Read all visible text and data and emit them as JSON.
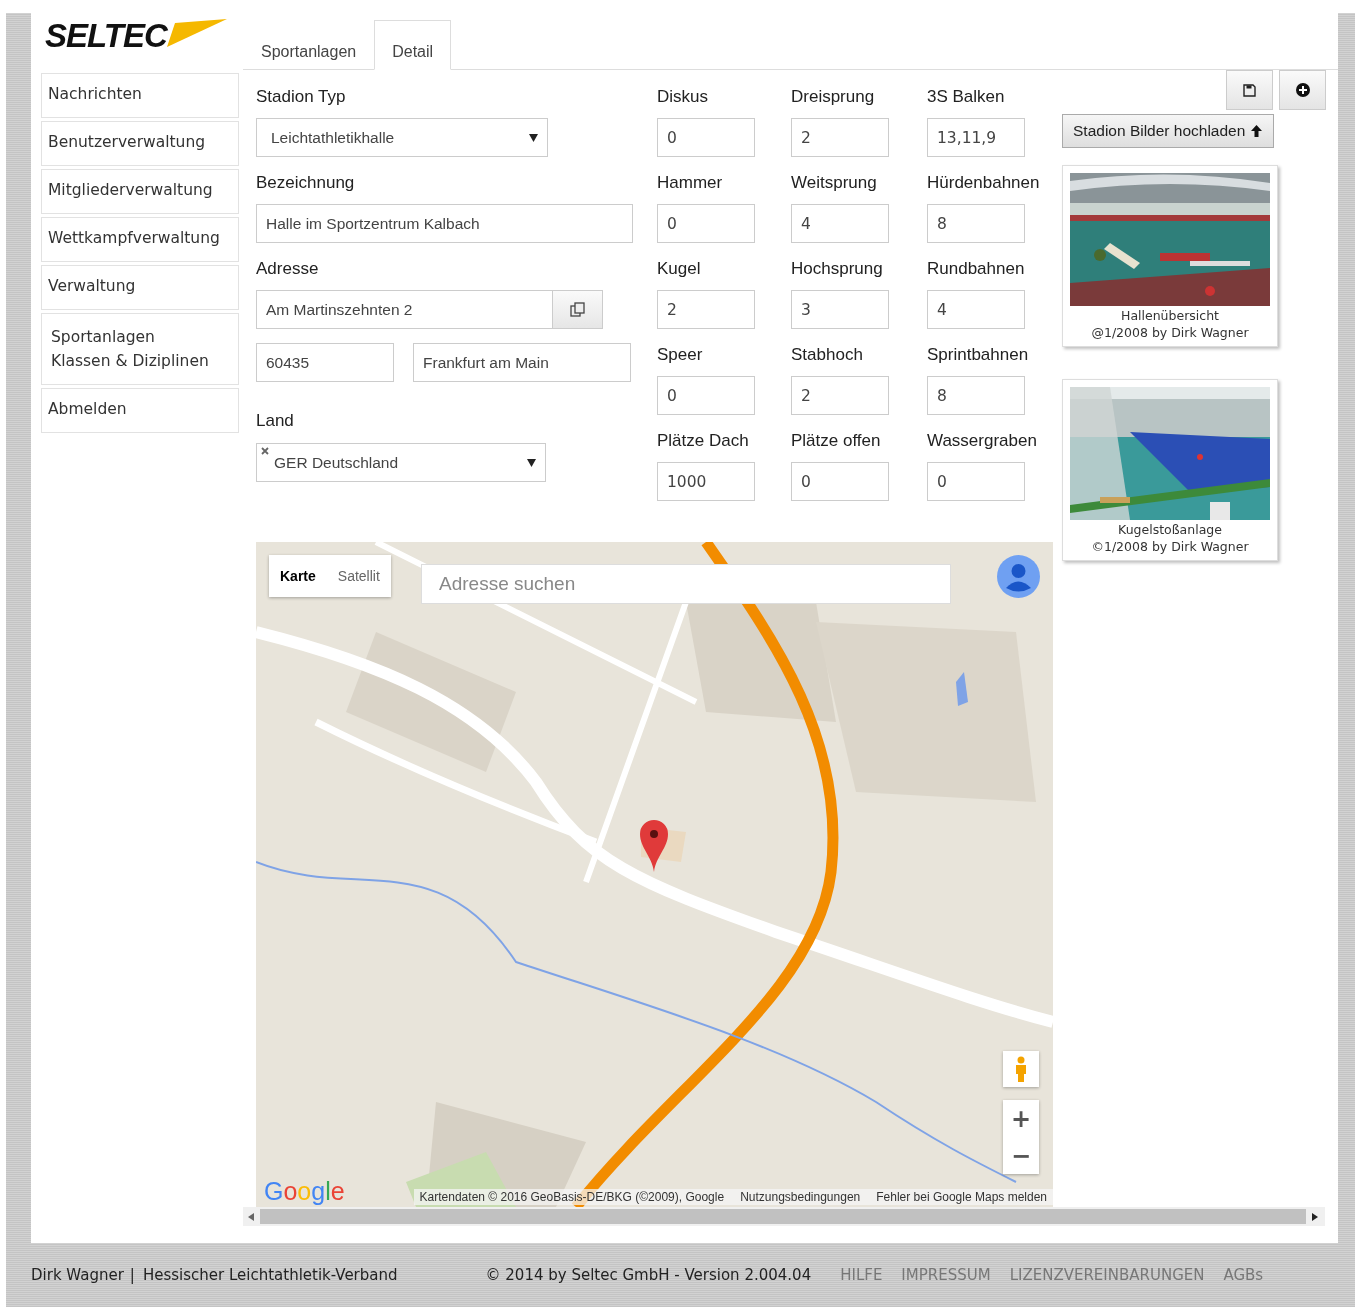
{
  "logo": {
    "text": "SELTEC"
  },
  "tabs": [
    {
      "label": "Sportanlagen",
      "selected": false
    },
    {
      "label": "Detail",
      "selected": true
    }
  ],
  "sidebar": [
    {
      "lines": [
        "Nachrichten"
      ]
    },
    {
      "lines": [
        "Benutzerverwaltung"
      ]
    },
    {
      "lines": [
        "Mitgliederverwaltung"
      ]
    },
    {
      "lines": [
        "Wettkampfverwaltung"
      ]
    },
    {
      "lines": [
        "Verwaltung"
      ]
    },
    {
      "lines": [
        "Sportanlagen",
        "Klassen & Diziplinen"
      ]
    },
    {
      "lines": [
        "Abmelden"
      ]
    }
  ],
  "form": {
    "stadion_typ": {
      "label": "Stadion Typ",
      "value": "Leichtathletikhalle"
    },
    "bezeichnung": {
      "label": "Bezeichnung",
      "value": "Halle im Sportzentrum Kalbach"
    },
    "adresse": {
      "label": "Adresse",
      "street": "Am Martinszehnten 2",
      "zip": "60435",
      "city": "Frankfurt am Main"
    },
    "land": {
      "label": "Land",
      "value": "GER Deutschland"
    }
  },
  "fields": [
    {
      "label": "Diskus",
      "value": "0"
    },
    {
      "label": "Dreisprung",
      "value": "2"
    },
    {
      "label": "3S Balken",
      "value": "13,11,9"
    },
    {
      "label": "Hammer",
      "value": "0"
    },
    {
      "label": "Weitsprung",
      "value": "4"
    },
    {
      "label": "Hürdenbahnen",
      "value": "8"
    },
    {
      "label": "Kugel",
      "value": "2"
    },
    {
      "label": "Hochsprung",
      "value": "3"
    },
    {
      "label": "Rundbahnen",
      "value": "4"
    },
    {
      "label": "Speer",
      "value": "0"
    },
    {
      "label": "Stabhoch",
      "value": "2"
    },
    {
      "label": "Sprintbahnen",
      "value": "8"
    },
    {
      "label": "Plätze Dach",
      "value": "1000"
    },
    {
      "label": "Plätze offen",
      "value": "0"
    },
    {
      "label": "Wassergraben",
      "value": "0"
    }
  ],
  "upload_button": {
    "label": "Stadion Bilder hochladen"
  },
  "photos": [
    {
      "kind": "picture",
      "title": "Hallenübersicht",
      "credit": "@1/2008 by Dirk Wagner"
    },
    {
      "kind": "picture",
      "title": "Kugelstoßanlage",
      "credit": "©1/2008 by Dirk Wagner"
    }
  ],
  "map": {
    "map_types": [
      {
        "label": "Karte",
        "selected": true
      },
      {
        "label": "Satellit",
        "selected": false
      }
    ],
    "search": {
      "placeholder": "Adresse suchen"
    },
    "logo": "Google",
    "attribution": "Kartendaten © 2016 GeoBasis-DE/BKG (©2009), Google",
    "links": [
      "Nutzungsbedingungen",
      "Fehler bei Google Maps melden"
    ],
    "zoom": [
      "+",
      "−"
    ]
  },
  "footer": {
    "user": "Dirk Wagner",
    "separator": "|",
    "org": "Hessischer Leichtathletik-Verband",
    "copyright": "© 2014 by Seltec GmbH - Version 2.004.04",
    "links": [
      "HILFE",
      "IMPRESSUM",
      "LIZENZVEREINBARUNGEN",
      "AGBs"
    ]
  }
}
